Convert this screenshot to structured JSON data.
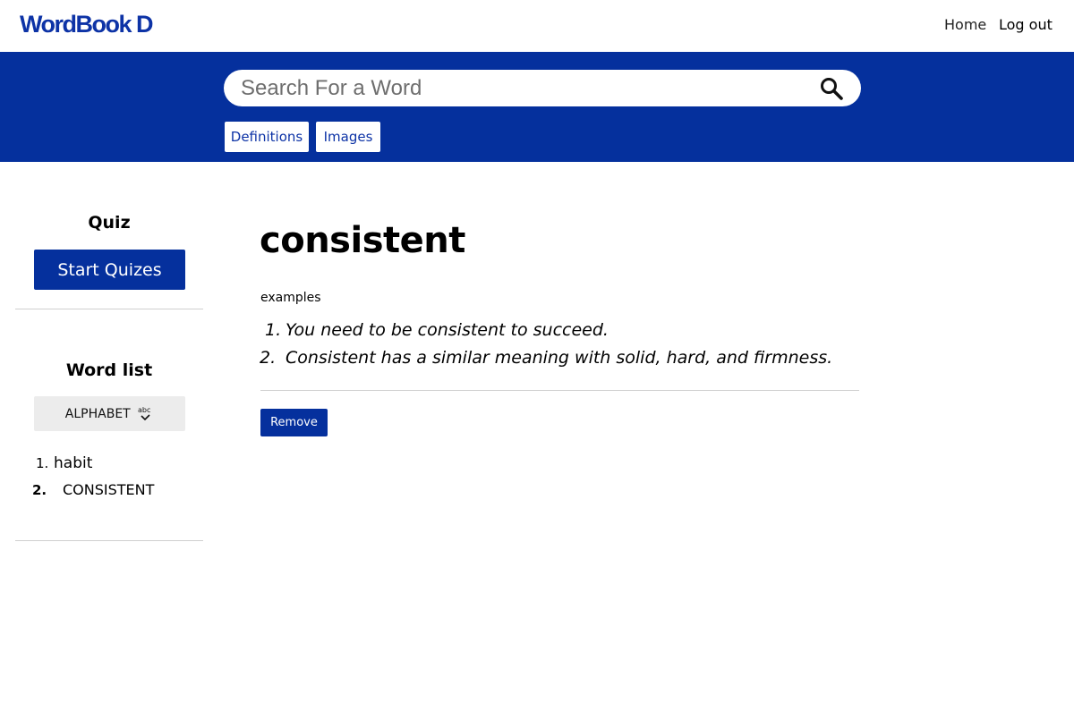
{
  "header": {
    "logo": "WordBook D",
    "nav": {
      "home": "Home",
      "logout": "Log out"
    }
  },
  "search": {
    "placeholder": "Search For a Word",
    "value": "",
    "tabs": {
      "definitions": "Definitions",
      "images": "Images"
    }
  },
  "sidebar": {
    "quiz": {
      "heading": "Quiz",
      "start_button": "Start Quizes"
    },
    "word_list": {
      "heading": "Word list",
      "sort_button": "ALPHABET",
      "items": [
        {
          "num": "1.",
          "word": "habit"
        },
        {
          "num": "2.",
          "word": "CONSISTENT"
        }
      ]
    }
  },
  "main": {
    "word": "consistent",
    "examples_label": "examples",
    "examples": [
      {
        "num": "1.",
        "text": "You need to be consistent to succeed."
      },
      {
        "num": "2.",
        "text": "Consistent has a similar meaning with solid, hard, and firmness."
      }
    ],
    "remove_button": "Remove"
  },
  "colors": {
    "brand_blue": "#05309d",
    "logo_blue": "#0d33a6",
    "sort_button_bg": "#ececec"
  }
}
